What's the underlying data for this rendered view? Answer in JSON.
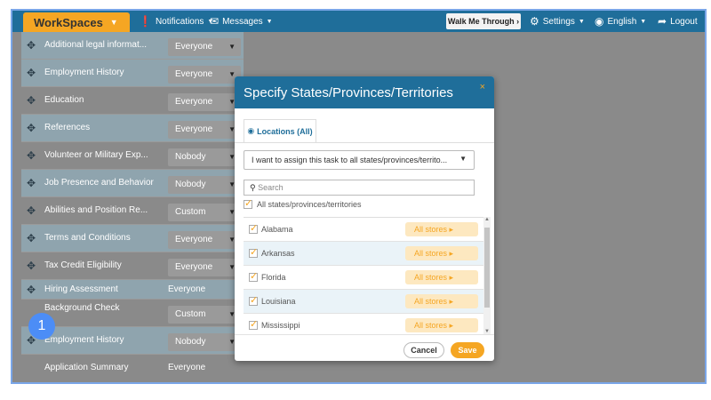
{
  "topbar": {
    "workspaces": "WorkSpaces",
    "notifications": "Notifications",
    "messages": "Messages",
    "walk_me": "Walk Me Through ›",
    "settings": "Settings",
    "language": "English",
    "logout": "Logout"
  },
  "list": [
    {
      "label": "Additional legal informat...",
      "value": "Everyone"
    },
    {
      "label": "Employment History",
      "value": "Everyone"
    },
    {
      "label": "Education",
      "value": "Everyone"
    },
    {
      "label": "References",
      "value": "Everyone"
    },
    {
      "label": "Volunteer or Military Exp...",
      "value": "Nobody"
    },
    {
      "label": "Job Presence and Behavior",
      "value": "Nobody"
    },
    {
      "label": "Abilities and Position Re...",
      "value": "Custom"
    },
    {
      "label": "Terms and Conditions",
      "value": "Everyone"
    },
    {
      "label": "Tax Credit Eligibility",
      "value": "Everyone"
    },
    {
      "label": "Hiring Assessment",
      "value": "Everyone"
    },
    {
      "label": "Background Check",
      "value": "Custom"
    },
    {
      "label": "Employment History",
      "value": "Nobody"
    },
    {
      "label": "Application Summary",
      "value": "Everyone"
    }
  ],
  "step_badge": "1",
  "modal": {
    "title": "Specify States/Provinces/Territories",
    "close": "×",
    "tab": "Locations (All)",
    "assign_select": "I want to assign this task to all states/provinces/territo...",
    "search_placeholder": "Search",
    "all_label": "All states/provinces/territories",
    "states": [
      {
        "name": "Alabama",
        "stores": "All stores ▸"
      },
      {
        "name": "Arkansas",
        "stores": "All stores ▸"
      },
      {
        "name": "Florida",
        "stores": "All stores ▸"
      },
      {
        "name": "Louisiana",
        "stores": "All stores ▸"
      },
      {
        "name": "Mississippi",
        "stores": "All stores ▸"
      }
    ],
    "cancel": "Cancel",
    "save": "Save"
  }
}
